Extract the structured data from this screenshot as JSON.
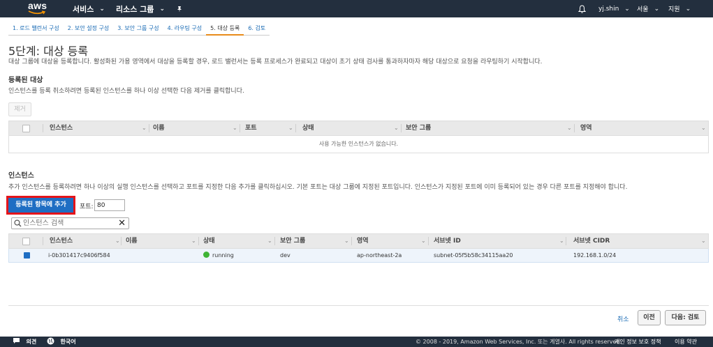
{
  "nav": {
    "logo": "aws",
    "services": "서비스",
    "resource_groups": "리소스 그룹",
    "user": "yj.shin",
    "region": "서울",
    "support": "지원"
  },
  "tabs": [
    {
      "label": "1. 로드 밸런서 구성"
    },
    {
      "label": "2. 보안 설정 구성"
    },
    {
      "label": "3. 보안 그룹 구성"
    },
    {
      "label": "4. 라우팅 구성"
    },
    {
      "label": "5. 대상 등록"
    },
    {
      "label": "6. 검토"
    }
  ],
  "page": {
    "title": "5단계: 대상 등록",
    "description": "대상 그룹에 대상을 등록합니다. 활성화된 가용 영역에서 대상을 등록할 경우, 로드 밸런서는 등록 프로세스가 완료되고 대상이 초기 상태 검사를 통과하자마자 해당 대상으로 요청을 라우팅하기 시작합니다."
  },
  "registered": {
    "title": "등록된 대상",
    "description": "인스턴스를 등록 취소하려면 등록된 인스턴스를 하나 이상 선택한 다음 제거를 클릭합니다.",
    "remove_label": "제거",
    "columns": [
      "인스턴스",
      "이름",
      "포트",
      "상태",
      "보안 그룹",
      "영역"
    ],
    "empty_text": "사용 가능한 인스턴스가 없습니다."
  },
  "instances": {
    "title": "인스턴스",
    "description": "추가 인스턴스를 등록하려면 하나 이상의 실행 인스턴스를 선택하고 포트를 지정한 다음 추가를 클릭하십시오. 기본 포트는 대상 그룹에 지정된 포트입니다. 인스턴스가 지정된 포트에 이미 등록되어 있는 경우 다른 포트를 지정해야 합니다.",
    "add_label": "등록된 항목에 추가",
    "port_label": "포트:",
    "port_value": "80",
    "search_placeholder": "인스턴스 검색",
    "columns": [
      "인스턴스",
      "이름",
      "상태",
      "보안 그룹",
      "영역",
      "서브넷 ID",
      "서브넷 CIDR"
    ],
    "rows": [
      {
        "instance": "i-0b301417c9406f584",
        "name": "",
        "state": "running",
        "security_group": "dev",
        "zone": "ap-northeast-2a",
        "subnet_id": "subnet-05f5b58c34115aa20",
        "subnet_cidr": "192.168.1.0/24"
      }
    ]
  },
  "actions": {
    "cancel": "취소",
    "previous": "이전",
    "next": "다음: 검토"
  },
  "footer": {
    "feedback": "의견",
    "language": "한국어",
    "copyright": "© 2008 - 2019, Amazon Web Services, Inc. 또는 계열사. All rights reserved.",
    "privacy": "개인 정보 보호 정책",
    "terms": "이용 약관"
  },
  "colors": {
    "nav_bg": "#232f3e",
    "primary": "#1f6ec3",
    "highlight": "#e5141a",
    "running": "#3fb435",
    "active_tab": "#e88b1a"
  }
}
